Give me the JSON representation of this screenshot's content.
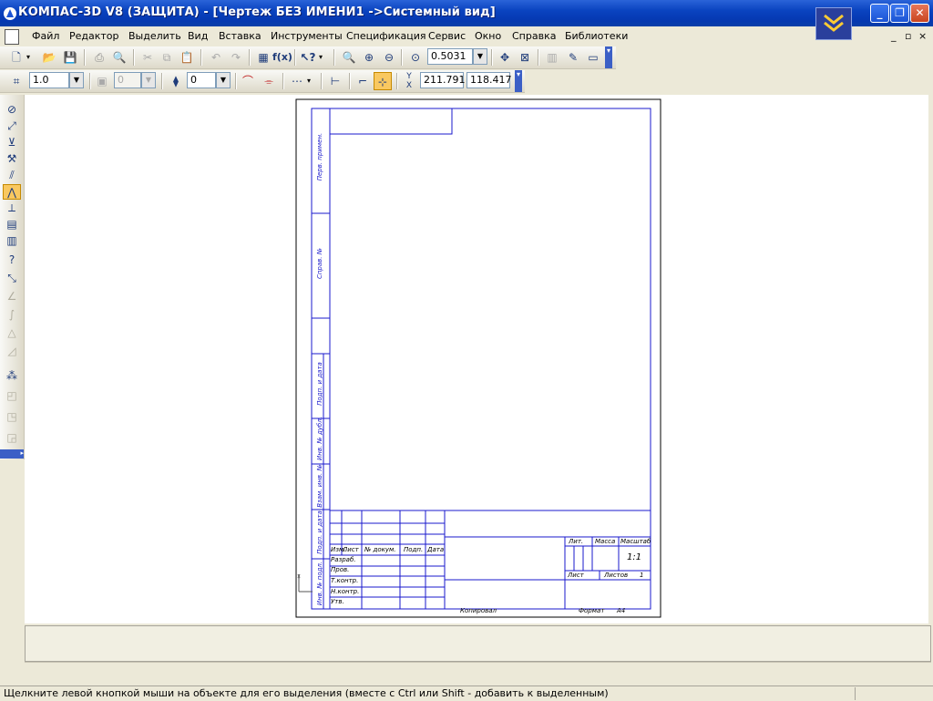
{
  "window": {
    "title": "КОМПАС-3D V8 (ЗАЩИТА) - [Чертеж БЕЗ ИМЕНИ1 ->Системный вид]",
    "app_icon": "kompas-logo-icon",
    "buttons": [
      "minimize-icon",
      "restore-icon",
      "close-icon"
    ]
  },
  "menu": {
    "items": [
      "Файл",
      "Редактор",
      "Выделить",
      "Вид",
      "Вставка",
      "Инструменты",
      "Спецификация",
      "Сервис",
      "Окно",
      "Справка",
      "Библиотеки"
    ],
    "doc_controls": [
      "_",
      "▫",
      "×"
    ]
  },
  "toolbar_standard": {
    "zoom_value": "0.5031"
  },
  "toolbar_current_state": {
    "step_value": "1.0",
    "layer_value": "0",
    "style_value": "0",
    "coord_x": "211.791",
    "coord_y": "118.417"
  },
  "drawing": {
    "side_labels": [
      "Перв. примен.",
      "Справ. №",
      "Подп. и дата",
      "Инв. № дубл.",
      "Взам. инв. №",
      "Подп. и дата",
      "Инв. № подл."
    ],
    "title_block": {
      "col_headers": [
        "Изм.",
        "Лист",
        "№ докум.",
        "Подп.",
        "Дата"
      ],
      "row_labels": [
        "Разраб.",
        "Пров.",
        "Т.контр.",
        "Н.контр.",
        "Утв."
      ],
      "lit": "Лит.",
      "massa": "Масса",
      "masshtab": "Масштаб",
      "scale_value": "1:1",
      "list": "Лист",
      "listov": "Листов",
      "listov_value": "1",
      "copied": "Копировал",
      "format": "Формат",
      "format_value": "A4"
    }
  },
  "statusbar": {
    "message": "Щелкните левой кнопкой мыши на объекте для его выделения (вместе с Ctrl или Shift - добавить к выделенным)"
  },
  "colors": {
    "titlebar": "#0a43c0",
    "frame_line": "#1a1acc",
    "canvas": "#ffffff"
  }
}
